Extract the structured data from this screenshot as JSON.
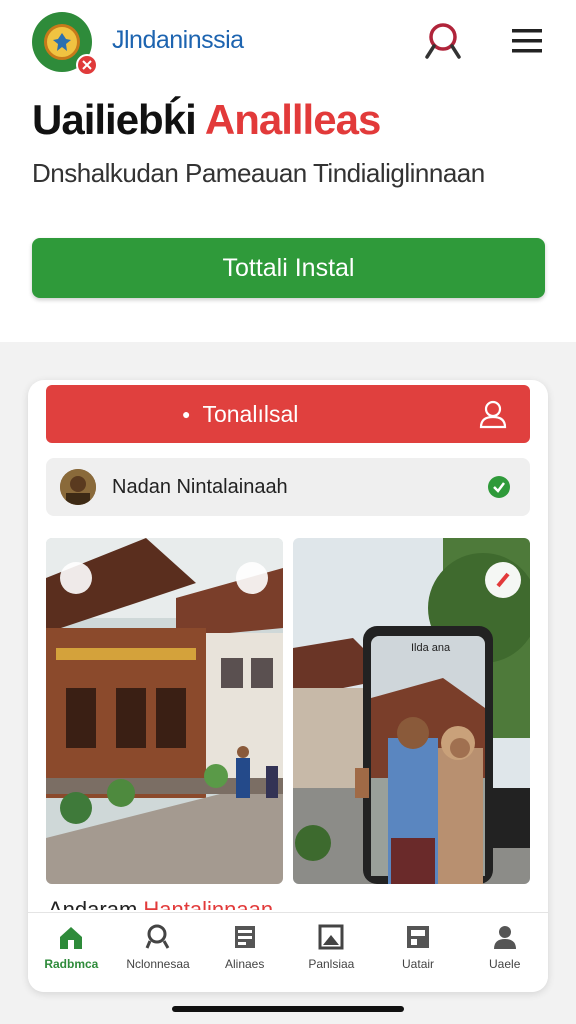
{
  "header": {
    "brand": "Jlndaninssia",
    "headline_dark": "Uailiebḱi",
    "headline_red": "Anallleas",
    "subtitle": "Dnshalkudan Pameauan Tindialiglinnaan",
    "install_label": "Tottali Instal"
  },
  "card": {
    "bar_label": "Tonalılsal",
    "info_text": "Nadan Nintalainaah",
    "caption_dark": "Andaram",
    "caption_red": "Hantalinnaan"
  },
  "phone_screen_label": "Ilda ana",
  "nav": [
    {
      "label": "Radbmca",
      "icon": "home-icon"
    },
    {
      "label": "Nclonnesaa",
      "icon": "search-person-icon"
    },
    {
      "label": "Alinaes",
      "icon": "document-icon"
    },
    {
      "label": "Panlsiaa",
      "icon": "image-icon"
    },
    {
      "label": "Uatair",
      "icon": "chart-icon"
    },
    {
      "label": "Uaele",
      "icon": "user-icon"
    }
  ],
  "colors": {
    "brand_blue": "#1d64b0",
    "accent_red": "#e23a3a",
    "accent_green": "#2f9a3a"
  }
}
